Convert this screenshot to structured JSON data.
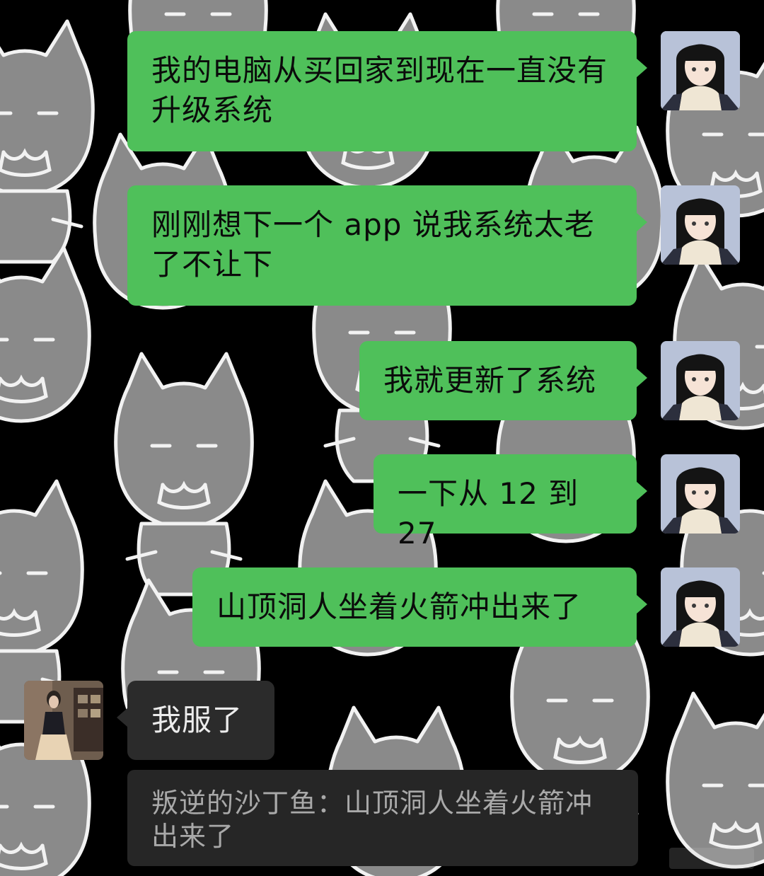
{
  "chat": {
    "messages": [
      {
        "direction": "outgoing",
        "text": "我的电脑从买回家到现在一直没有升级系统"
      },
      {
        "direction": "outgoing",
        "text": "刚刚想下一个 app 说我系统太老了不让下"
      },
      {
        "direction": "outgoing",
        "text": "我就更新了系统"
      },
      {
        "direction": "outgoing",
        "text": "一下从 12 到 27"
      },
      {
        "direction": "outgoing",
        "text": "山顶洞人坐着火箭冲出来了"
      },
      {
        "direction": "incoming",
        "text": "我服了"
      }
    ],
    "quoted_reply": "叛逆的沙丁鱼：山顶洞人坐着火箭冲出来了"
  },
  "colors": {
    "background": "#000000",
    "outgoing_bubble": "#4fc05a",
    "incoming_bubble": "#2b2b2b",
    "quote_bubble": "#262626"
  },
  "icons": {
    "self_avatar": "anime-girl-scarf-avatar",
    "other_avatar": "woman-photo-avatar",
    "background_pattern": "cartoon-cat-doodles"
  }
}
